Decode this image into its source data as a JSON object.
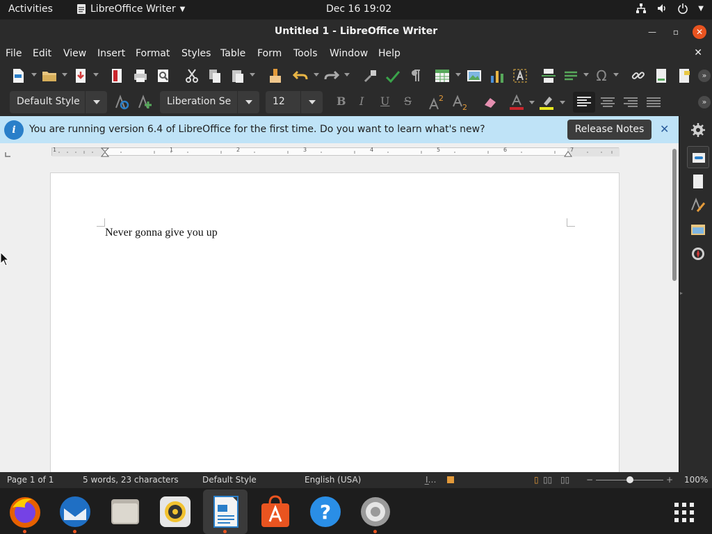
{
  "topbar": {
    "activities": "Activities",
    "app_name": "LibreOffice Writer",
    "clock": "Dec 16  19:02"
  },
  "window": {
    "title": "Untitled 1 - LibreOffice Writer"
  },
  "menu": [
    "File",
    "Edit",
    "View",
    "Insert",
    "Format",
    "Styles",
    "Table",
    "Form",
    "Tools",
    "Window",
    "Help"
  ],
  "formatting": {
    "paragraph_style": "Default Style",
    "font_name": "Liberation Se",
    "font_size": "12"
  },
  "infobar": {
    "message": "You are running version 6.4 of LibreOffice for the first time. Do you want to learn what's new?",
    "button": "Release Notes"
  },
  "document": {
    "text": "Never gonna give you up"
  },
  "ruler": {
    "labels": [
      "1",
      "1",
      "2",
      "3",
      "4",
      "5",
      "6",
      "7"
    ]
  },
  "status": {
    "page": "Page 1 of 1",
    "words": "5 words, 23 characters",
    "style": "Default Style",
    "language": "English (USA)",
    "zoom": "100%"
  },
  "colors": {
    "accent": "#e95420",
    "infobar": "#bfe3f7",
    "toolbar": "#2b2b2b"
  }
}
